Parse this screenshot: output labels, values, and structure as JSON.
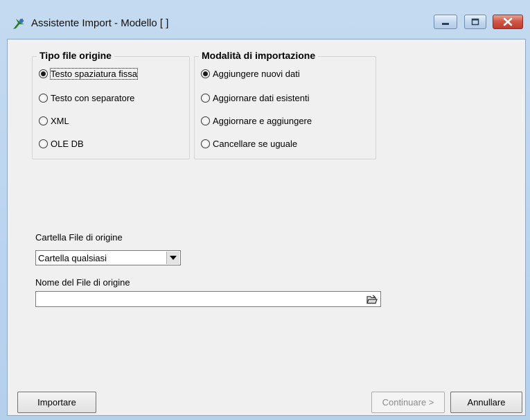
{
  "window": {
    "title": "Assistente Import - Modello [ ]"
  },
  "source_type": {
    "title": "Tipo file origine",
    "options": [
      {
        "label": "Testo spaziatura fissa",
        "checked": true
      },
      {
        "label": "Testo con separatore",
        "checked": false
      },
      {
        "label": "XML",
        "checked": false
      },
      {
        "label": "OLE DB",
        "checked": false
      }
    ]
  },
  "import_mode": {
    "title": "Modalità di importazione",
    "options": [
      {
        "label": "Aggiungere nuovi dati",
        "checked": true
      },
      {
        "label": "Aggiornare dati esistenti",
        "checked": false
      },
      {
        "label": "Aggiornare e aggiungere",
        "checked": false
      },
      {
        "label": "Cancellare se uguale",
        "checked": false
      }
    ]
  },
  "source_folder": {
    "label": "Cartella File di origine",
    "selected": "Cartella qualsiasi"
  },
  "source_file": {
    "label": "Nome del File di origine",
    "value": ""
  },
  "buttons": {
    "import": "Importare",
    "continue": "Continuare >",
    "cancel": "Annullare"
  },
  "colors": {
    "accent": "#1d6fb0",
    "close": "#c03a2b",
    "disabled_text": "#8a8a8a"
  }
}
